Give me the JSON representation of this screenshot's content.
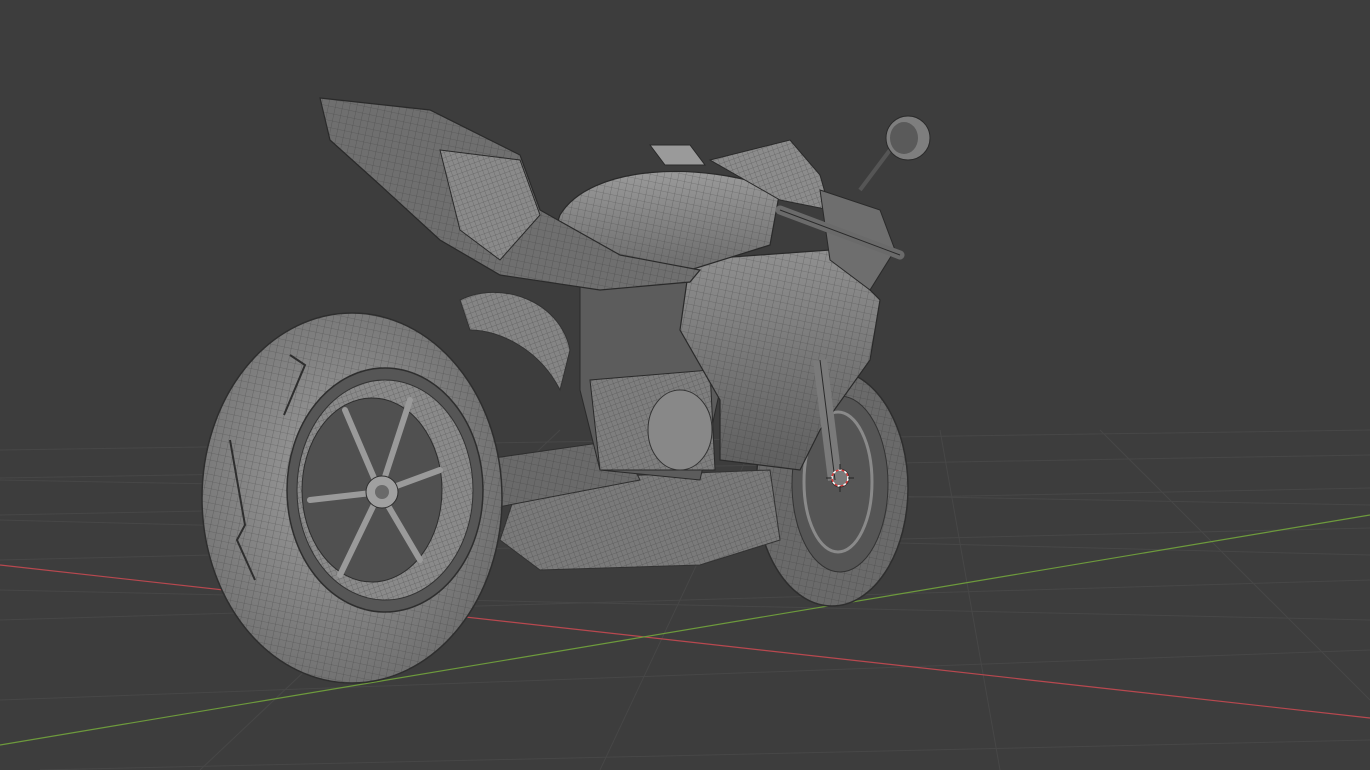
{
  "viewport": {
    "name": "3D Viewport",
    "background": "#3d3d3d",
    "grid_color": "#474747",
    "x_axis_color": "#b8484f",
    "y_axis_color": "#6d9a3c",
    "object": "motorcycle-mesh",
    "shading": "solid-wireframe-overlay",
    "cursor": "3d-cursor-icon"
  }
}
